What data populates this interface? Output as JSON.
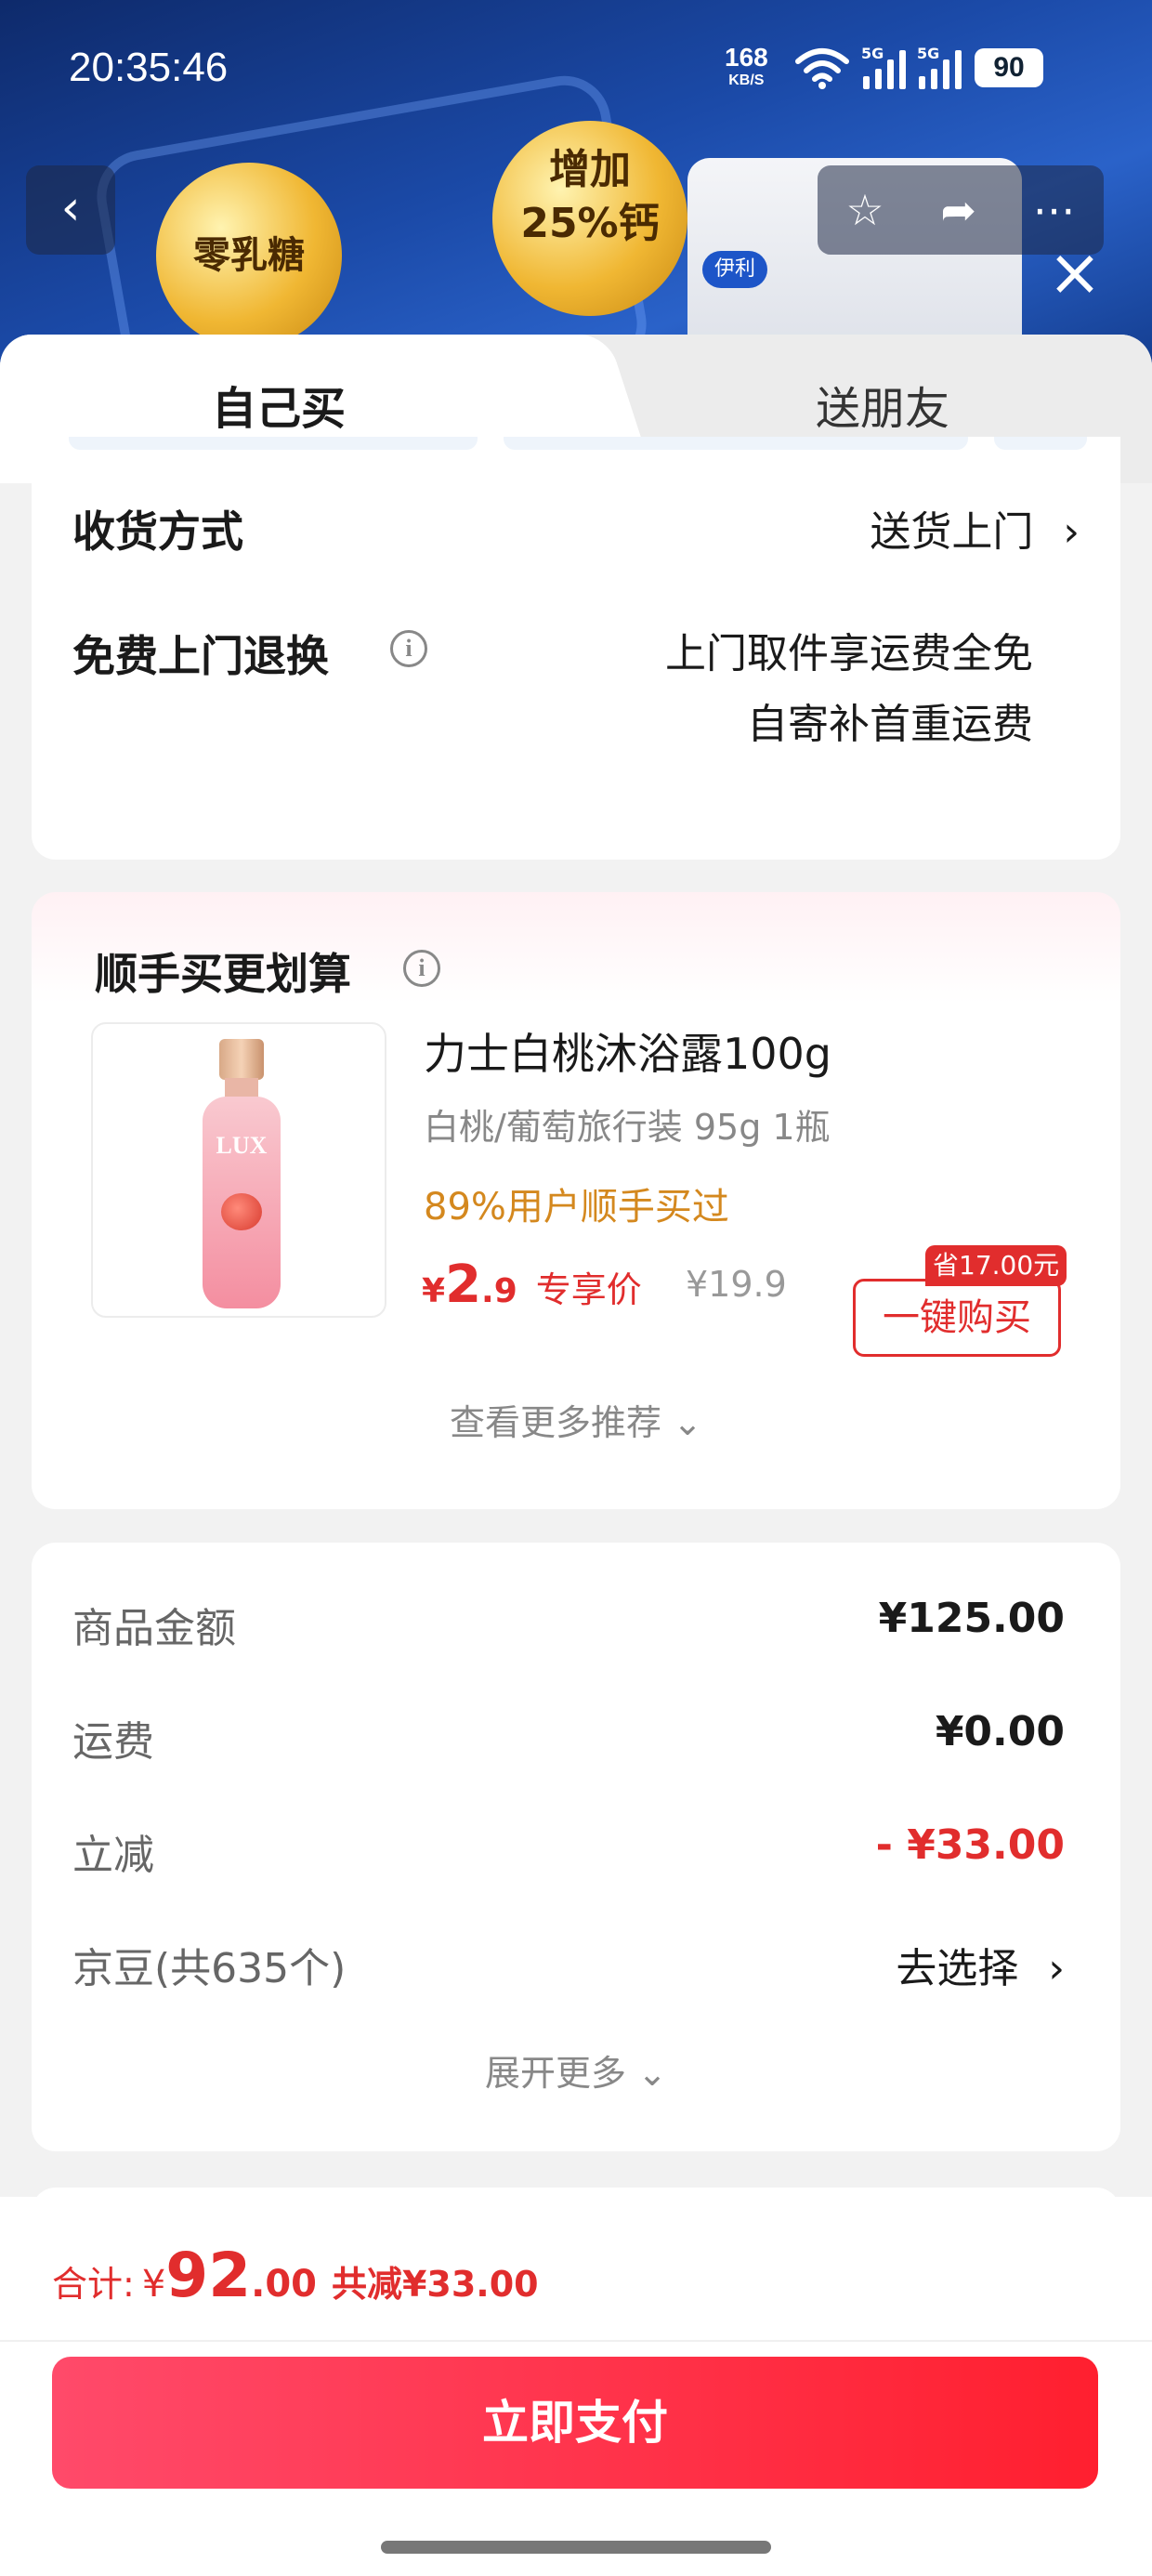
{
  "status_bar": {
    "time": "20:35:46",
    "net_speed": "168",
    "net_unit": "KB/S",
    "sim1": "5G",
    "sim2": "5G",
    "battery": "90"
  },
  "banner": {
    "badge1": "增加\n25%钙",
    "badge2": "零乳糖",
    "brand": "伊利"
  },
  "tabs": {
    "self": "自己买",
    "friend": "送朋友"
  },
  "delivery": {
    "label": "收货方式",
    "value": "送货上门"
  },
  "returns": {
    "label": "免费上门退换",
    "line1": "上门取件享运费全免",
    "line2": "自寄补首重运费"
  },
  "addon": {
    "title": "顺手买更划算",
    "product": {
      "name": "力士白桃沐浴露100g",
      "spec": "白桃/葡萄旅行装 95g 1瓶",
      "bought": "89%用户顺手买过",
      "price_symbol": "¥",
      "price_int": "2",
      "price_dec": ".9",
      "price_tag": "专享价",
      "original_price": "¥19.9",
      "save_badge": "省17.00元",
      "buy_label": "一键购买",
      "logo": "LUX"
    },
    "more": "查看更多推荐"
  },
  "fees": {
    "rows": [
      {
        "label": "商品金额",
        "value": "¥125.00"
      },
      {
        "label": "运费",
        "value": "¥0.00"
      },
      {
        "label": "立减",
        "value": "- ¥33.00"
      },
      {
        "label": "京豆(共635个)",
        "value": "去选择"
      }
    ],
    "expand": "展开更多"
  },
  "footer": {
    "total_label": "合计:",
    "total_symbol": "¥",
    "total_int": "92",
    "total_dec": ".00",
    "total_save": "共减¥33.00",
    "pay_label": "立即支付"
  },
  "colors": {
    "accent_red": "#e12d2d",
    "orange": "#d4881e",
    "pay_gradient_start": "#ff4a6a",
    "pay_gradient_end": "#ff1f2f"
  },
  "icons": [
    "back-arrow-icon",
    "star-icon",
    "share-icon",
    "more-icon",
    "close-icon",
    "info-icon",
    "chevron-right-icon",
    "chevron-down-icon",
    "wifi-icon",
    "signal-icon"
  ]
}
